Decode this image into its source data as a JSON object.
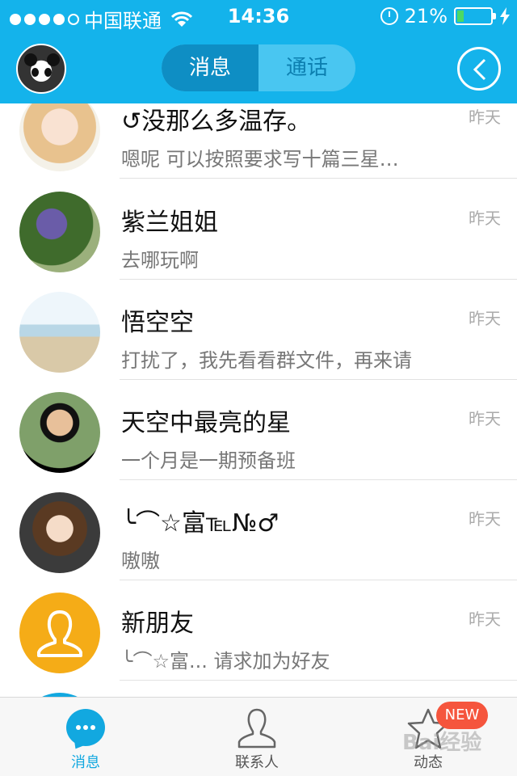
{
  "status": {
    "carrier": "中国联通",
    "time": "14:36",
    "battery": "21%",
    "battery_level": 0.21
  },
  "header": {
    "tabs": [
      {
        "label": "消息",
        "active": true
      },
      {
        "label": "通话",
        "active": false
      }
    ]
  },
  "conversations": [
    {
      "name": "↺没那么多温存。",
      "time": "昨天",
      "preview": "嗯呢 可以按照要求写十篇三星…"
    },
    {
      "name": "紫兰姐姐",
      "time": "昨天",
      "preview": "去哪玩啊"
    },
    {
      "name": "悟空空",
      "time": "昨天",
      "preview": "打扰了，我先看看群文件，再来请"
    },
    {
      "name": "天空中最亮的星",
      "time": "昨天",
      "preview": "一个月是一期预备班"
    },
    {
      "name": "╰⌒☆富℡№♂",
      "time": "昨天",
      "preview": "嗷嗷"
    },
    {
      "name": "新朋友",
      "time": "昨天",
      "preview": "╰⌒☆富... 请求加为好友"
    }
  ],
  "tabbar": [
    {
      "label": "消息",
      "icon": "chat-bubble-icon",
      "active": true
    },
    {
      "label": "联系人",
      "icon": "contacts-icon",
      "active": false
    },
    {
      "label": "动态",
      "icon": "star-icon",
      "active": false,
      "badge": "NEW"
    }
  ],
  "watermark": "Bai经验",
  "colors": {
    "header": "#14b3eb",
    "accent": "#12a8e0",
    "badge": "#f5553d"
  }
}
